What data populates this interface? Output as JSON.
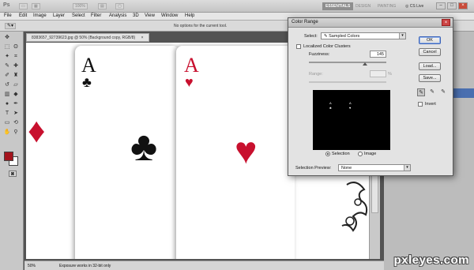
{
  "app": {
    "logo": "Ps",
    "mode_control": "100%",
    "workspaces": [
      "ESSENTIALS",
      "DESIGN",
      "PAINTING"
    ],
    "cs_live": "CS Live",
    "window_controls": [
      "–",
      "□",
      "×"
    ]
  },
  "menu": {
    "items": [
      "File",
      "Edit",
      "Image",
      "Layer",
      "Select",
      "Filter",
      "Analysis",
      "3D",
      "View",
      "Window",
      "Help"
    ]
  },
  "options_bar": {
    "message": "No options for the current tool."
  },
  "document": {
    "tab_title": "8383657_92739623.jpg @ 50% (Background copy, RGB/8)",
    "tab_close": "×",
    "zoom": "50%",
    "status_message": "Exposure works in 32-bit only",
    "cards": [
      {
        "rank": "A",
        "suit": "♣",
        "color": "#111111"
      },
      {
        "rank": "A",
        "suit": "♥",
        "color": "#c8102e"
      }
    ],
    "left_card_suit": "♦",
    "center_club": "♣",
    "center_heart": "♥",
    "fg_color": "#a4141d",
    "bg_color": "#ffffff"
  },
  "dialog": {
    "title": "Color Range",
    "close": "×",
    "select_label": "Select:",
    "select_value": "Sampled Colors",
    "localized_label": "Localized Color Clusters",
    "localized_checked": false,
    "fuzziness_label": "Fuzziness:",
    "fuzziness_value": "145",
    "fuzziness_level": 0.72,
    "range_label": "Range:",
    "range_unit": "%",
    "selection_radio": "Selection",
    "image_radio": "Image",
    "selected_view": "Selection",
    "preview_label": "Selection Preview:",
    "preview_value": "None",
    "buttons": {
      "ok": "OK",
      "cancel": "Cancel",
      "load": "Load...",
      "save": "Save..."
    },
    "invert_label": "Invert",
    "invert_checked": false,
    "preview_dots": [
      {
        "label": "A",
        "suit": "♣"
      },
      {
        "label": "A",
        "suit": "♥"
      }
    ]
  },
  "watermark": "pxleyes.com"
}
